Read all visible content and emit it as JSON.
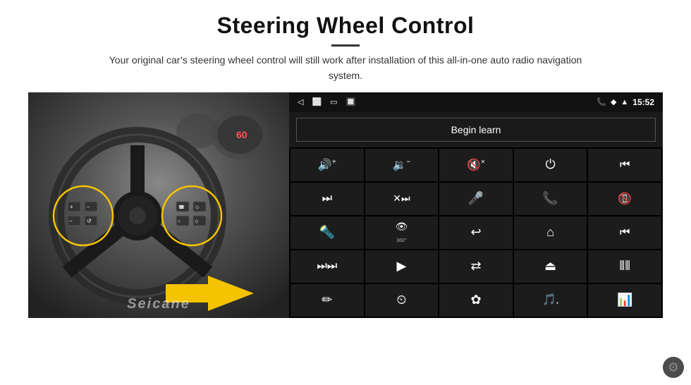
{
  "header": {
    "title": "Steering Wheel Control",
    "divider": true,
    "subtitle": "Your original car’s steering wheel control will still work after installation of this all-in-one auto radio navigation system."
  },
  "status_bar": {
    "back_icon": "◁",
    "home_icon": "□",
    "recent_icon": "□",
    "signal_icon": "☱",
    "phone_icon": "☎",
    "wifi_icon": "▲",
    "signal_bars": "|||",
    "time": "15:52"
  },
  "begin_learn": {
    "label": "Begin learn"
  },
  "grid_buttons": [
    {
      "icon": "🔊+",
      "unicode": "🔊+",
      "label": "vol_up"
    },
    {
      "icon": "🔉−",
      "unicode": "🔉−",
      "label": "vol_down"
    },
    {
      "icon": "🔇×",
      "unicode": "🔇×",
      "label": "mute"
    },
    {
      "icon": "⏻",
      "unicode": "⏻",
      "label": "power"
    },
    {
      "icon": "⏮",
      "unicode": "⏮",
      "label": "prev_track"
    },
    {
      "icon": "⏭",
      "unicode": "⏭",
      "label": "next"
    },
    {
      "icon": "✕⏭",
      "unicode": "✕⏭",
      "label": "shuffle_next"
    },
    {
      "icon": "🎤",
      "unicode": "🎤",
      "label": "mic"
    },
    {
      "icon": "☎",
      "unicode": "☎",
      "label": "phone"
    },
    {
      "icon": "↘",
      "unicode": "↙",
      "label": "hang_up"
    },
    {
      "icon": "🔦",
      "unicode": "🔦",
      "label": "light"
    },
    {
      "icon": "👁°",
      "unicode": "👁360",
      "label": "camera_360"
    },
    {
      "icon": "↩",
      "unicode": "↩",
      "label": "back"
    },
    {
      "icon": "⌂",
      "unicode": "⌂",
      "label": "home"
    },
    {
      "icon": "⏮",
      "unicode": "⏮",
      "label": "skip_back"
    },
    {
      "icon": "⏭⏭",
      "unicode": "⏭⏭",
      "label": "fast_forward"
    },
    {
      "icon": "‣",
      "unicode": "▶",
      "label": "navigate"
    },
    {
      "icon": "⇄",
      "unicode": "⇄",
      "label": "swap"
    },
    {
      "icon": "⎙",
      "unicode": "⏏",
      "label": "eject"
    },
    {
      "icon": "⦀",
      "unicode": "⦀",
      "label": "equalizer"
    },
    {
      "icon": "✏",
      "unicode": "✏",
      "label": "pen"
    },
    {
      "icon": "⏲",
      "unicode": "⏲",
      "label": "clock"
    },
    {
      "icon": "✿",
      "unicode": "✿",
      "label": "bluetooth"
    },
    {
      "icon": "🎵",
      "unicode": "🎵",
      "label": "music"
    },
    {
      "icon": "⦀⦀",
      "unicode": "⦀⦀",
      "label": "equalizer2"
    }
  ],
  "watermark": {
    "text": "Seicane"
  },
  "gear_icon": "⚙"
}
